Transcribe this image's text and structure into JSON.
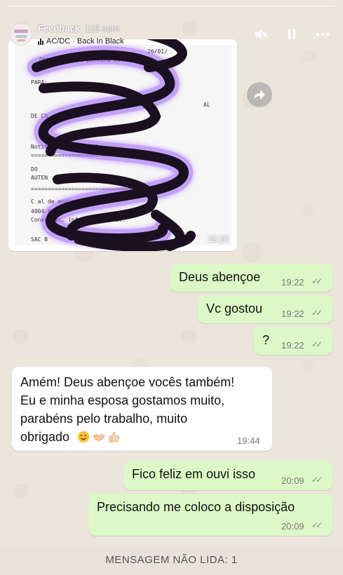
{
  "story": {
    "user_name": "Feedback",
    "time_ago": "118 sem",
    "music": "AC/DC · Back In Black",
    "icons": [
      "mute-icon",
      "pause-icon",
      "more-icon"
    ]
  },
  "image_message": {
    "time": "18:26",
    "receipt_lines": [
      "26/01/",
      "DESCRICAO:              da pintura externa",
      "PARA:",
      "**",
      "AL",
      "DE CO        .82821787",
      "Notificacao envi              .42",
      "=================================",
      "DO",
      "AUTEN                  .CDD.DDD.A3D",
      "===================================",
      "C    al de    endimento BB",
      "4004 0001",
      "Consultas, inf        e s     ssionais.",
      "SAC B"
    ]
  },
  "messages": [
    {
      "dir": "out",
      "text": "Deus abençoe",
      "time": "19:22",
      "read": true
    },
    {
      "dir": "out",
      "text": "Vc gostou",
      "time": "19:22",
      "read": true
    },
    {
      "dir": "out",
      "text": "?",
      "time": "19:22",
      "read": true
    },
    {
      "dir": "in",
      "lines": [
        "Amém! Deus abençoe vocês também!",
        "Eu e minha esposa gostamos muito,",
        "parabéns pelo trabalho, muito",
        "obrigado"
      ],
      "emojis": [
        "wink-emoji",
        "handshake-emoji",
        "thumbs-up-emoji"
      ],
      "time": "19:44"
    },
    {
      "dir": "out",
      "text": "Fico feliz em ouvi isso",
      "time": "20:09",
      "read": true
    },
    {
      "dir": "out",
      "text": "Precisando me coloco a disposição",
      "time": "20:09",
      "read": true
    }
  ],
  "unread_banner": "MENSAGEM NÃO LIDA: 1",
  "colors": {
    "outgoing": "#dcf8c6",
    "incoming": "#ffffff",
    "background": "#ece5dc",
    "scribble": "#1a1020",
    "glow": "#9b5cff"
  }
}
